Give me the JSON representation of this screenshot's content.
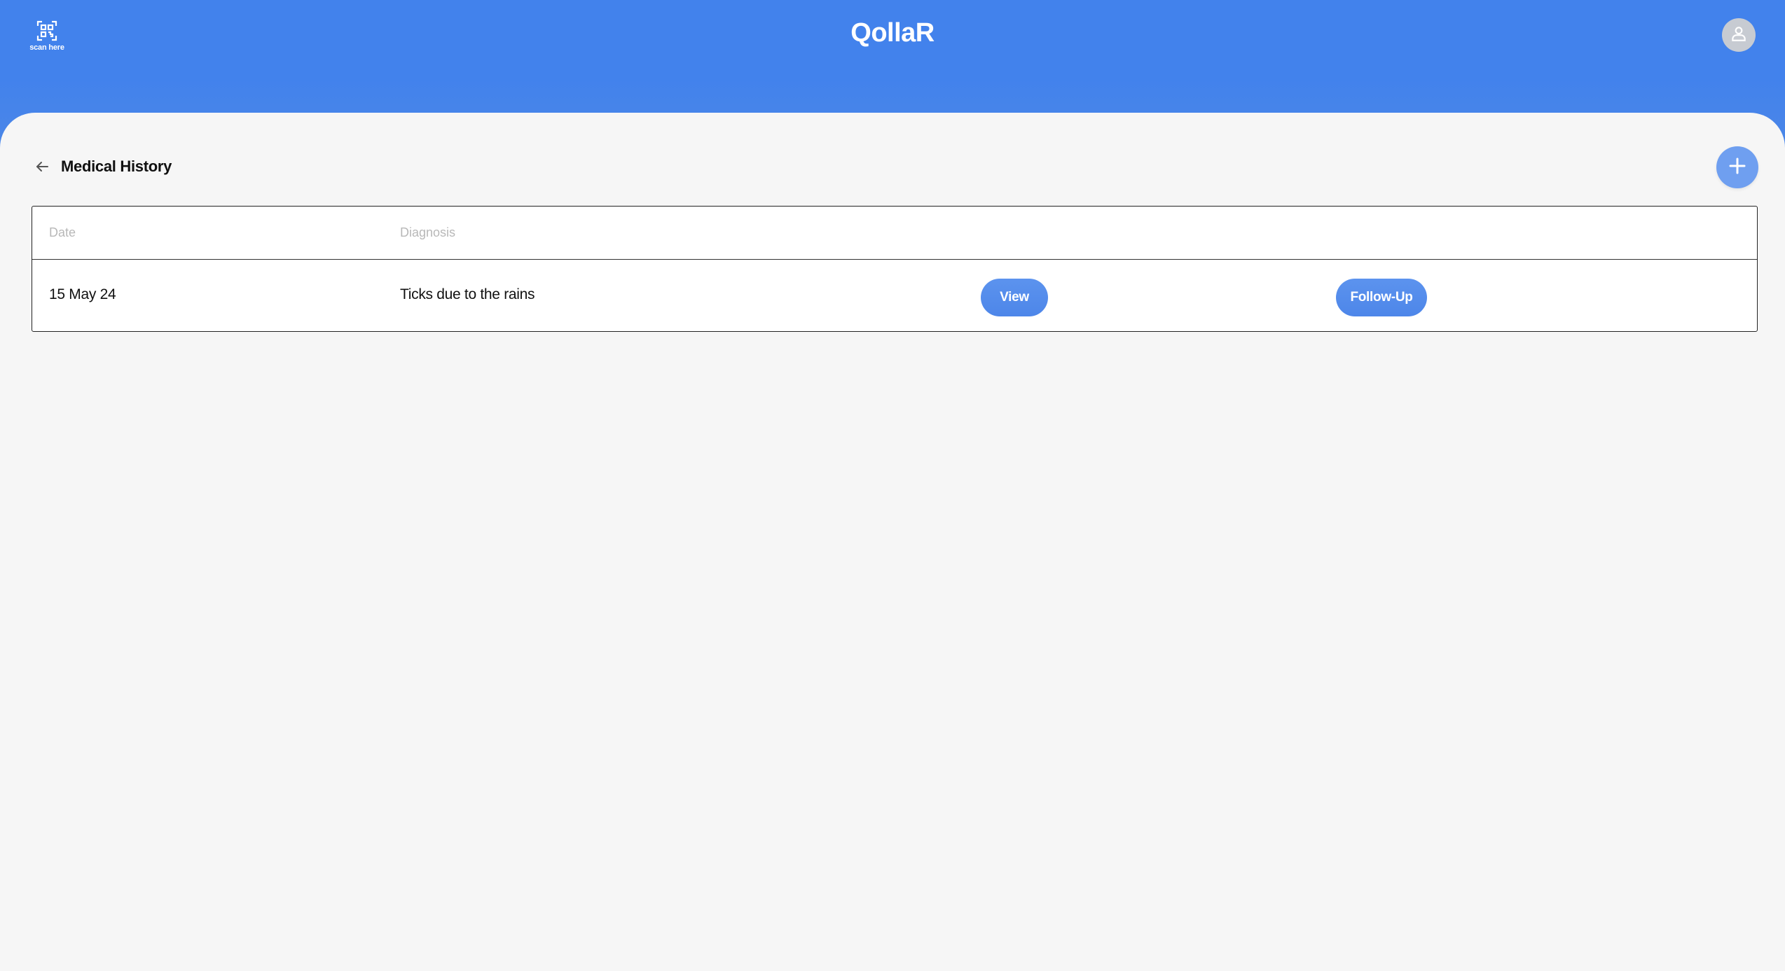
{
  "header": {
    "app_title": "QollaR",
    "scan_label": "scan here",
    "scan_icon": "qr-scan-icon",
    "profile_icon": "user-icon",
    "brand_color": "#4282EC"
  },
  "page": {
    "title": "Medical History",
    "back_icon": "arrow-left-icon",
    "add_icon": "plus-icon"
  },
  "table": {
    "columns": [
      "Date",
      "Diagnosis"
    ],
    "rows": [
      {
        "date": "15 May 24",
        "diagnosis": "Ticks due to the rains",
        "view_label": "View",
        "followup_label": "Follow-Up"
      }
    ]
  }
}
